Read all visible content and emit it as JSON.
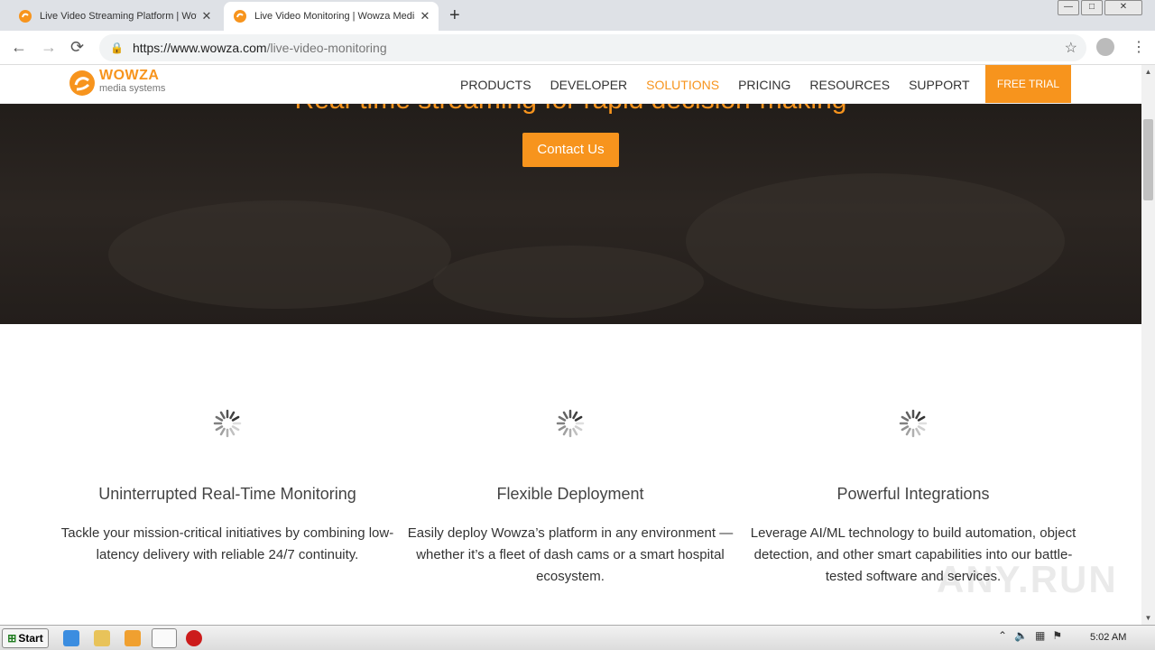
{
  "browser": {
    "tabs": [
      {
        "title": "Live Video Streaming Platform | Wowza",
        "active": false
      },
      {
        "title": "Live Video Monitoring | Wowza Media",
        "active": true
      }
    ],
    "url_host": "https://www.wowza.com",
    "url_path": "/live-video-monitoring",
    "win_buttons": [
      "—",
      "□",
      "✕"
    ]
  },
  "site": {
    "logo": {
      "brand": "WOWZA",
      "sub": "media systems"
    },
    "nav": [
      "PRODUCTS",
      "DEVELOPER",
      "SOLUTIONS",
      "PRICING",
      "RESOURCES",
      "SUPPORT"
    ],
    "nav_active": "SOLUTIONS",
    "free_trial": "FREE TRIAL",
    "accent": "#f7941d",
    "hero": {
      "heading": "Real-time streaming for rapid decision-making",
      "cta": "Contact Us"
    },
    "features": [
      {
        "title": "Uninterrupted Real-Time Monitoring",
        "desc": "Tackle your mission-critical initiatives by combining low-latency delivery with reliable 24/7 continuity."
      },
      {
        "title": "Flexible Deployment",
        "desc": "Easily deploy Wowza’s platform in any environment — whether it’s a fleet of dash cams or a smart hospital ecosystem."
      },
      {
        "title": "Powerful Integrations",
        "desc": "Leverage AI/ML technology to build automation, object detection, and other smart capabilities into our battle-tested software and services."
      }
    ]
  },
  "watermark": "ANY.RUN",
  "taskbar": {
    "start": "Start",
    "clock": "5:02 AM"
  }
}
